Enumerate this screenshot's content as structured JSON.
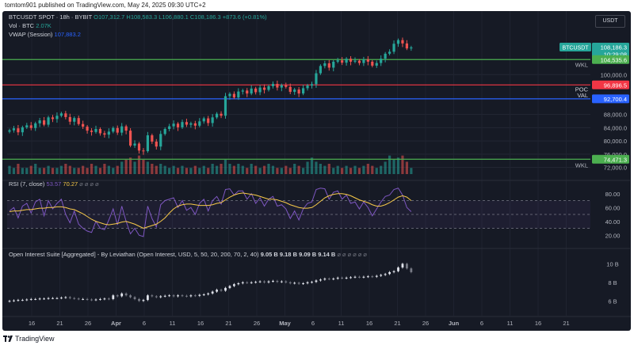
{
  "credit": "tomtom901 published on TradingView.com, May 24, 2025 09:30 UTC+2",
  "footer_brand": "TradingView",
  "currency_button": "USDT",
  "header": {
    "symbol": "BTCUSDT SPOT · 18h · BYBIT",
    "ohlc": "O107,312.7 H108,583.3 L106,880.1 C108,186.3 +873.6 (+0.81%)",
    "vol_label": "Vol · BTC",
    "vol_value": "2.07K",
    "vwap_label": "VWAP (Session)",
    "vwap_value": "107,883.2",
    "rsi_label": "RSI (7, close)",
    "rsi_value1": "53.57",
    "rsi_value2": "70.27",
    "rsi_na": "⌀ ⌀ ⌀ ⌀",
    "oi_label": "Open Interest Suite [Aggregated] - By Leviathan (Open Interest, USD, 5, 50, 20, 200, 70, 2, 40)",
    "oi_values": "9.05 B  9.18 B  9.09 B  9.14 B",
    "oi_na": "⌀ ⌀ ⌀ ⌀ ⌀ ⌀"
  },
  "price_axis": {
    "ticks": [
      "100,000.0",
      "88,000.0",
      "84,000.0",
      "80,000.0",
      "76,000.0",
      "72,000.0"
    ],
    "tick_values": [
      100000,
      88000,
      84000,
      80000,
      76000,
      72000
    ]
  },
  "price_labels": {
    "symbol_tag": "BTCUSDT",
    "last_price": "108,186.3",
    "countdown": "10:29:08",
    "wkl_upper_value": "104,535.6",
    "poc_value": "96,896.5",
    "val_value": "92,700.4",
    "wkl_lower_value": "74,471.3",
    "wkl_text": "WKL",
    "poc_text": "POC",
    "val_text": "VAL"
  },
  "levels": {
    "wkl_upper": 104535.6,
    "poc": 96896.5,
    "val": 92700.4,
    "wkl_lower": 74471.3
  },
  "rsi_axis": {
    "ticks": [
      "80.00",
      "60.00",
      "40.00",
      "20.00"
    ],
    "tick_values": [
      80,
      60,
      40,
      20
    ]
  },
  "oi_axis": {
    "ticks": [
      "10 B",
      "8 B",
      "6 B"
    ],
    "tick_values": [
      10,
      8,
      6
    ]
  },
  "time_axis": {
    "labels": [
      "16",
      "21",
      "26",
      "Apr",
      "6",
      "11",
      "16",
      "21",
      "26",
      "May",
      "6",
      "11",
      "16",
      "21",
      "26",
      "Jun",
      "6",
      "11",
      "16",
      "21"
    ],
    "bold": [
      "Apr",
      "May",
      "Jun"
    ]
  },
  "colors": {
    "bg": "#161a25",
    "up": "#26a69a",
    "down": "#ef5350",
    "wkl": "#4caf50",
    "poc": "#f23645",
    "val": "#2962ff",
    "rsi": "#7e57c2",
    "rsi_ma": "#f7c948",
    "axis_text": "#b2b5be"
  },
  "chart_data": {
    "type": "candlestick",
    "interval": "18h",
    "period": "2025-03-16 to 2025-05-24",
    "price_ylim": [
      70000,
      112000
    ],
    "closes": [
      83200,
      83800,
      82600,
      84100,
      84700,
      83900,
      85300,
      86200,
      84900,
      87100,
      86600,
      87600,
      88300,
      87200,
      85800,
      86900,
      85100,
      84300,
      83100,
      82700,
      83600,
      82300,
      81900,
      82800,
      83900,
      82500,
      84400,
      83100,
      78600,
      79200,
      77100,
      76900,
      81700,
      79800,
      78300,
      82100,
      83600,
      84400,
      85200,
      84100,
      85700,
      84900,
      85300,
      84600,
      85900,
      86800,
      85400,
      87100,
      88200,
      87600,
      93500,
      94200,
      93100,
      94900,
      95200,
      94300,
      95800,
      94700,
      96100,
      95400,
      96500,
      97200,
      96100,
      96800,
      96300,
      94800,
      95500,
      94300,
      95900,
      96700,
      97100,
      100400,
      102600,
      103400,
      102100,
      103900,
      104300,
      103600,
      104800,
      103900,
      104200,
      103500,
      104600,
      103900,
      102700,
      103500,
      104800,
      106300,
      106900,
      109300,
      110400,
      109400,
      107900,
      108186
    ],
    "volume_relative": [
      0.4,
      0.3,
      0.5,
      0.3,
      0.3,
      0.4,
      0.5,
      0.3,
      0.3,
      0.4,
      0.3,
      0.3,
      0.4,
      0.5,
      0.4,
      0.3,
      0.3,
      0.4,
      0.3,
      0.5,
      0.4,
      0.3,
      0.5,
      0.4,
      0.3,
      0.4,
      0.6,
      0.7,
      0.8,
      0.6,
      0.9,
      0.7,
      0.6,
      0.5,
      0.4,
      0.5,
      0.4,
      0.3,
      0.4,
      0.3,
      0.4,
      0.3,
      0.3,
      0.4,
      0.3,
      0.4,
      0.3,
      0.5,
      0.4,
      0.5,
      0.7,
      0.5,
      0.4,
      0.5,
      0.4,
      0.3,
      0.5,
      0.4,
      0.3,
      0.4,
      0.5,
      0.4,
      0.3,
      0.3,
      0.4,
      0.3,
      0.5,
      0.4,
      0.3,
      0.6,
      0.8,
      0.6,
      0.5,
      0.4,
      0.5,
      0.3,
      0.4,
      0.3,
      0.4,
      0.3,
      0.4,
      0.3,
      0.4,
      0.5,
      0.4,
      0.3,
      0.4,
      0.6,
      0.9,
      0.7,
      0.8,
      0.9,
      0.6,
      0.3
    ],
    "rsi_ylim": [
      10,
      90
    ],
    "rsi": [
      55,
      60,
      45,
      62,
      66,
      52,
      68,
      72,
      48,
      70,
      58,
      66,
      72,
      50,
      38,
      55,
      36,
      30,
      26,
      24,
      40,
      30,
      28,
      42,
      58,
      35,
      62,
      40,
      22,
      30,
      20,
      18,
      62,
      44,
      32,
      64,
      70,
      72,
      74,
      60,
      70,
      56,
      60,
      50,
      66,
      72,
      55,
      70,
      76,
      65,
      86,
      87,
      78,
      84,
      84,
      72,
      80,
      66,
      74,
      62,
      72,
      76,
      62,
      64,
      58,
      44,
      55,
      42,
      58,
      66,
      68,
      86,
      88,
      87,
      72,
      82,
      84,
      72,
      78,
      66,
      68,
      58,
      68,
      60,
      48,
      58,
      68,
      76,
      78,
      86,
      88,
      78,
      60,
      54
    ],
    "rsi_ma": [
      54,
      55,
      55,
      56,
      57,
      57,
      58,
      59,
      59,
      60,
      60,
      61,
      61,
      60,
      58,
      57,
      54,
      51,
      47,
      43,
      40,
      38,
      36,
      35,
      36,
      37,
      39,
      40,
      38,
      36,
      33,
      30,
      32,
      34,
      36,
      40,
      45,
      52,
      58,
      62,
      64,
      65,
      65,
      64,
      63,
      63,
      63,
      64,
      66,
      67,
      71,
      75,
      78,
      80,
      81,
      80,
      79,
      78,
      76,
      74,
      72,
      72,
      71,
      69,
      67,
      64,
      62,
      60,
      59,
      59,
      60,
      64,
      69,
      74,
      77,
      79,
      80,
      80,
      79,
      77,
      74,
      71,
      69,
      67,
      64,
      62,
      62,
      64,
      67,
      71,
      75,
      77,
      75,
      70
    ],
    "oi_ylim": [
      5,
      10.8
    ],
    "oi_billions": [
      6.0,
      6.05,
      6.1,
      6.1,
      6.15,
      6.2,
      6.2,
      6.25,
      6.25,
      6.3,
      6.3,
      6.3,
      6.35,
      6.4,
      6.3,
      6.25,
      6.2,
      6.2,
      6.15,
      6.1,
      6.15,
      6.2,
      6.25,
      6.2,
      6.6,
      6.5,
      6.8,
      6.6,
      6.4,
      6.2,
      6.0,
      6.1,
      6.6,
      6.5,
      6.4,
      6.5,
      6.55,
      6.6,
      6.5,
      6.6,
      6.55,
      6.5,
      6.6,
      6.55,
      6.65,
      6.7,
      6.8,
      7.0,
      7.2,
      7.1,
      7.4,
      7.6,
      7.8,
      7.9,
      8.0,
      7.95,
      8.0,
      8.05,
      8.1,
      8.0,
      8.1,
      8.15,
      8.05,
      8.1,
      8.0,
      7.9,
      7.95,
      7.85,
      7.9,
      8.0,
      8.05,
      8.2,
      8.3,
      8.4,
      8.35,
      8.4,
      8.5,
      8.45,
      8.5,
      8.55,
      8.6,
      8.55,
      8.6,
      8.65,
      8.6,
      8.7,
      8.8,
      8.9,
      9.1,
      9.2,
      9.6,
      10.0,
      9.5,
      9.1
    ]
  }
}
